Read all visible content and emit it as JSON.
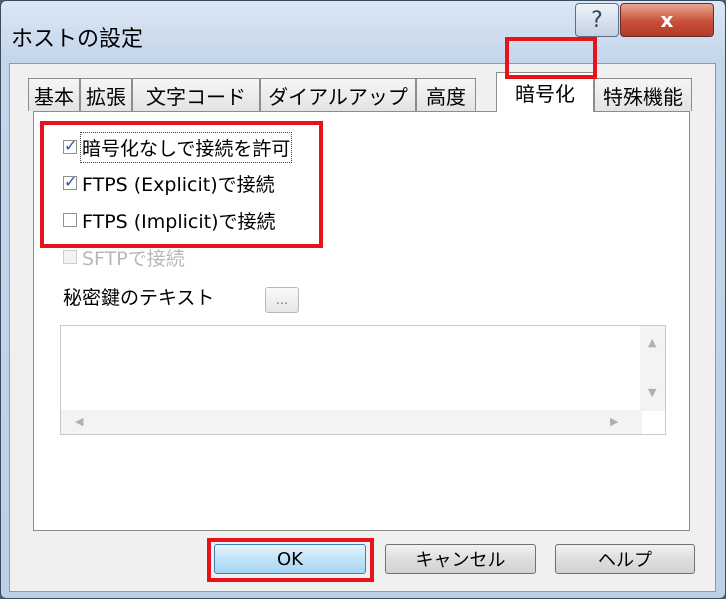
{
  "window": {
    "title": "ホストの設定",
    "help_label": "?",
    "close_label": "x"
  },
  "tabs": [
    {
      "label": "基本",
      "active": false
    },
    {
      "label": "拡張",
      "active": false
    },
    {
      "label": "文字コード",
      "active": false
    },
    {
      "label": "ダイアルアップ",
      "active": false
    },
    {
      "label": "高度",
      "active": false
    },
    {
      "label": "暗号化",
      "active": true
    },
    {
      "label": "特殊機能",
      "active": false
    }
  ],
  "encryption": {
    "options": [
      {
        "label": "暗号化なしで接続を許可",
        "checked": true,
        "enabled": true
      },
      {
        "label": "FTPS (Explicit)で接続",
        "checked": true,
        "enabled": true
      },
      {
        "label": "FTPS (Implicit)で接続",
        "checked": false,
        "enabled": true
      },
      {
        "label": "SFTPで接続",
        "checked": false,
        "enabled": false
      }
    ],
    "private_key_label": "秘密鍵のテキスト",
    "browse_label": "...",
    "private_key_text": ""
  },
  "buttons": {
    "ok": "OK",
    "cancel": "キャンセル",
    "help": "ヘルプ"
  },
  "colors": {
    "highlight": "#e8121b",
    "check": "#2a56a6"
  }
}
